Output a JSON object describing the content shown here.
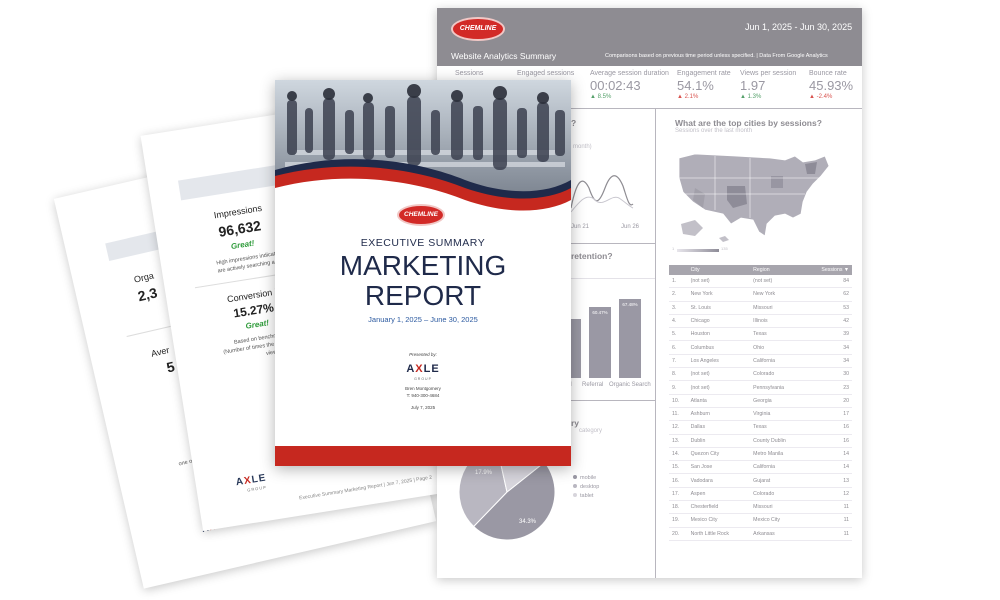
{
  "back_page_1": {
    "label": "Orga",
    "value": "2,3",
    "label2": "Aver",
    "value2": "5",
    "footnote_1": "E",
    "footnote_2": "one of the",
    "logo": "AXLE"
  },
  "back_page_2": {
    "metric_1_label": "Impressions",
    "metric_1_value": "96,632",
    "metric_1_rating": "Great!",
    "metric_1_note_1": "High impressions indicate",
    "metric_1_note_2": "are actively searching a term",
    "metric_2_label": "Conversion R",
    "metric_2_value": "15.27%",
    "metric_2_rating": "Great!",
    "metric_2_note_1": "Based on benchmark",
    "metric_2_note_2": "(Number of times the \"Conta",
    "metric_2_note_3": "viewed)",
    "logo": "AXLE",
    "logo_sub": "GROUP",
    "footer": "Executive Summary Marketing Report  |  Jun 7, 2025  |  Page 2"
  },
  "dashboard": {
    "brand": "CHEMLINE",
    "date_range": "Jun 1, 2025 - Jun 30, 2025",
    "title": "Website Analytics Summary",
    "subtitle": "Comparisons based on previous time period unless specified. | Data From Google Analytics",
    "kpis": [
      {
        "label": "Sessions",
        "value": "",
        "delta": ""
      },
      {
        "label": "Engaged sessions",
        "value": "",
        "delta": ""
      },
      {
        "label": "Average session duration",
        "value": "00:02:43",
        "delta": "▲ 8.5%",
        "trend": "up"
      },
      {
        "label": "Engagement rate",
        "value": "54.1%",
        "delta": "▲ 2.1%",
        "trend": "down"
      },
      {
        "label": "Views per session",
        "value": "1.97",
        "delta": "▲ 1.3%",
        "trend": "up"
      },
      {
        "label": "Bounce rate",
        "value": "45.93%",
        "delta": "▲ -2.4%",
        "trend": "down"
      }
    ],
    "panel_left_1_title": "?",
    "panel_left_1_sub": "month)",
    "line_ticks": [
      "Jun 21",
      "Jun 26"
    ],
    "panel_left_2_title": "retention?",
    "bars": [
      {
        "label": "al",
        "value": "",
        "pct": 0.5
      },
      {
        "label": "Referral",
        "value": "60.47%",
        "pct": 0.605
      },
      {
        "label": "Organic Search",
        "value": "67.48%",
        "pct": 0.675
      }
    ],
    "panel_left_3_title": "ry",
    "panel_left_3_sub": "category",
    "pie": {
      "slices": [
        {
          "name": "mobile",
          "value": 47.9,
          "color": "#9a98a4"
        },
        {
          "name": "desktop",
          "value": 34.3,
          "color": "#b9b7c1"
        },
        {
          "name": "tablet",
          "value": 17.8,
          "color": "#d7d5dc"
        }
      ],
      "label_1": "17.9%",
      "label_2": "34.3%"
    },
    "map_title": "What are the top cities by sessions?",
    "map_sub": "Sessions over the last month",
    "map_legend_min": "1",
    "map_legend_max": "135",
    "table_headers": [
      "City",
      "Region",
      "Sessions ▼"
    ],
    "cities": [
      [
        "1.",
        "(not set)",
        "(not set)",
        "84"
      ],
      [
        "2.",
        "New York",
        "New York",
        "62"
      ],
      [
        "3.",
        "St. Louis",
        "Missouri",
        "53"
      ],
      [
        "4.",
        "Chicago",
        "Illinois",
        "42"
      ],
      [
        "5.",
        "Houston",
        "Texas",
        "39"
      ],
      [
        "6.",
        "Columbus",
        "Ohio",
        "34"
      ],
      [
        "7.",
        "Los Angeles",
        "California",
        "34"
      ],
      [
        "8.",
        "(not set)",
        "Colorado",
        "30"
      ],
      [
        "9.",
        "(not set)",
        "Pennsylvania",
        "23"
      ],
      [
        "10.",
        "Atlanta",
        "Georgia",
        "20"
      ],
      [
        "11.",
        "Ashburn",
        "Virginia",
        "17"
      ],
      [
        "12.",
        "Dallas",
        "Texas",
        "16"
      ],
      [
        "13.",
        "Dublin",
        "County Dublin",
        "16"
      ],
      [
        "14.",
        "Quezon City",
        "Metro Manila",
        "14"
      ],
      [
        "15.",
        "San Jose",
        "California",
        "14"
      ],
      [
        "16.",
        "Vadodara",
        "Gujarat",
        "13"
      ],
      [
        "17.",
        "Aspen",
        "Colorado",
        "12"
      ],
      [
        "18.",
        "Chesterfield",
        "Missouri",
        "11"
      ],
      [
        "19.",
        "Mexico City",
        "Mexico City",
        "11"
      ],
      [
        "20.",
        "North Little Rock",
        "Arkansas",
        "11"
      ]
    ]
  },
  "cover": {
    "brand": "CHEMLINE",
    "kicker": "EXECUTIVE SUMMARY",
    "title_1": "MARKETING",
    "title_2": "REPORT",
    "date_range": "January 1, 2025 – June 30, 2025",
    "presented_by": "Presented by:",
    "agency": "AXLE",
    "agency_sub": "GROUP",
    "author": "Bren Montgomery",
    "phone": "T: 940-300-4684",
    "date": "July 7, 2025"
  },
  "colors": {
    "brand_red": "#d22a27",
    "navy": "#1f2a4a",
    "dash_grey": "#8e8c92"
  }
}
